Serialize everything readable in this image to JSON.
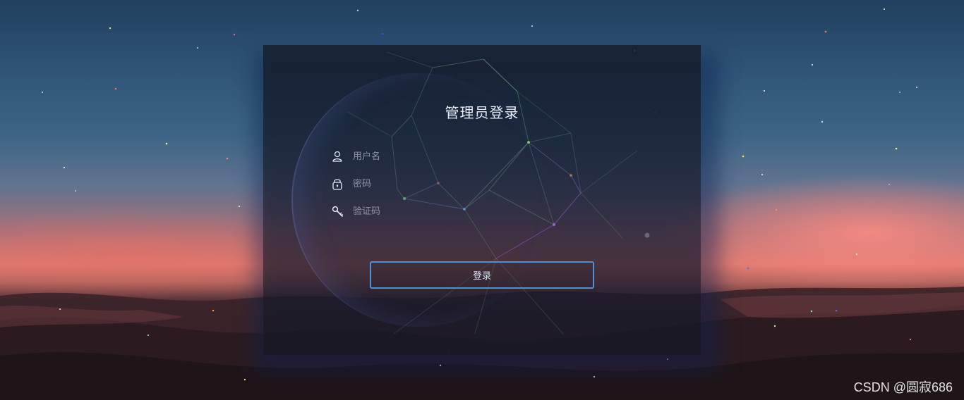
{
  "login": {
    "title": "管理员登录",
    "username": {
      "placeholder": "用户名",
      "value": "",
      "icon": "user-icon"
    },
    "password": {
      "placeholder": "密码",
      "value": "",
      "icon": "lock-icon"
    },
    "captcha": {
      "placeholder": "验证码",
      "value": "",
      "icon": "key-icon"
    },
    "submit_label": "登录"
  },
  "watermark": "CSDN @圆寂686",
  "colors": {
    "accent": "#4f8fd6",
    "title_text": "#e6ecf5",
    "placeholder_text": "#8f96a3",
    "panel_bg": "#141c28"
  }
}
